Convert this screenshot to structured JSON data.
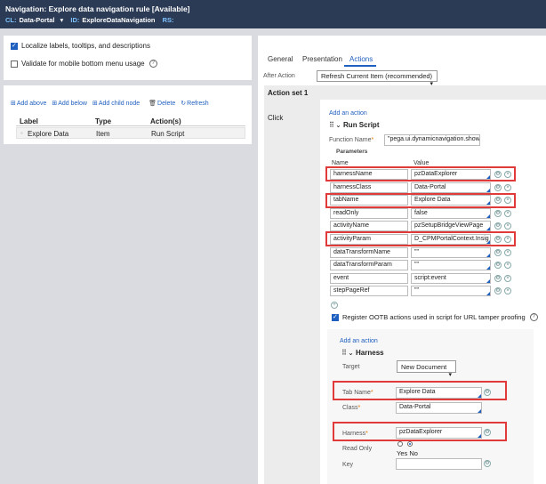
{
  "header": {
    "title": "Navigation: Explore data navigation rule [Available]",
    "cl_key": "CL:",
    "cl_value": "Data-Portal",
    "id_key": "ID:",
    "id_value": "ExploreDataNavigation",
    "rs_key": "RS:"
  },
  "left_options": {
    "localize_label": "Localize labels, tooltips, and descriptions",
    "validate_label": "Validate for mobile bottom menu usage"
  },
  "tree_toolbar": {
    "add_above": "Add above",
    "add_below": "Add below",
    "add_child": "Add child node",
    "delete": "Delete",
    "refresh": "Refresh"
  },
  "tree_table": {
    "headers": [
      "Label",
      "Type",
      "Action(s)"
    ],
    "rows": [
      {
        "label": "Explore Data",
        "type": "Item",
        "action": "Run Script"
      }
    ]
  },
  "tabs": [
    "General",
    "Presentation",
    "Actions"
  ],
  "after_action": {
    "label": "After Action",
    "value": "Refresh Current Item (recommended)"
  },
  "action_set": {
    "title": "Action set 1",
    "event": "Click",
    "add_action": "Add an action",
    "run_script": "Run Script",
    "function_name_label": "Function Name",
    "function_name_value": "\"pega.ui.dynamicnavigation.show",
    "parameters_label": "Parameters",
    "name_header": "Name",
    "value_header": "Value",
    "params": [
      {
        "name": "harnessName",
        "value": "pzDataExplorer"
      },
      {
        "name": "harnessClass",
        "value": "Data-Portal"
      },
      {
        "name": "tabName",
        "value": "Explore Data"
      },
      {
        "name": "readOnly",
        "value": "false"
      },
      {
        "name": "activityName",
        "value": "pzSetupBridgeViewPage"
      },
      {
        "name": "activityParam",
        "value": "D_CPMPortalContext.Insig"
      },
      {
        "name": "dataTransformName",
        "value": "\"\""
      },
      {
        "name": "dataTransformParam",
        "value": "\"\""
      },
      {
        "name": "event",
        "value": "script:event"
      },
      {
        "name": "stepPageRef",
        "value": "\"\""
      }
    ],
    "register_label": "Register OOTB actions used in script for URL tamper proofing"
  },
  "harness_action": {
    "add_action": "Add an action",
    "title": "Harness",
    "target_label": "Target",
    "target_value": "New Document",
    "tab_name_label": "Tab Name",
    "tab_name_value": "Explore Data",
    "class_label": "Class",
    "class_value": "Data-Portal",
    "harness_label": "Harness",
    "harness_value": "pzDataExplorer",
    "read_only_label": "Read Only",
    "yes": "Yes",
    "no": "No",
    "key_label": "Key"
  },
  "colors": {
    "header_bg": "#2b3a55",
    "accent": "#1f5fbf",
    "highlight": "#e03a3a"
  }
}
